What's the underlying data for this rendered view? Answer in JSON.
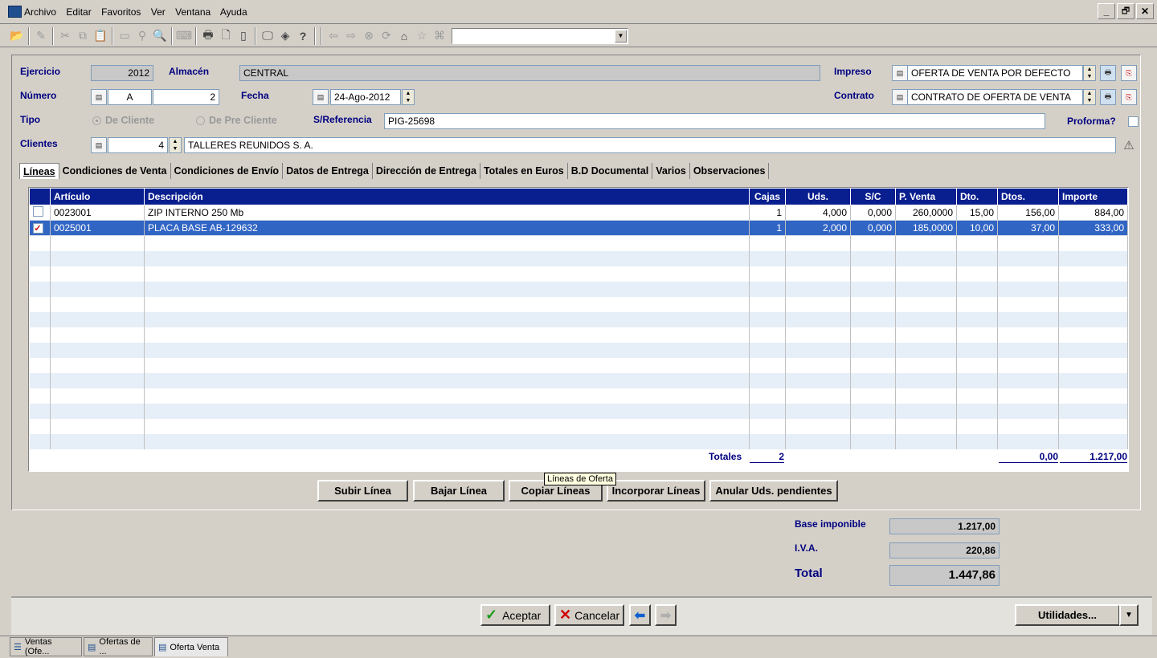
{
  "menu": {
    "items": [
      "Archivo",
      "Editar",
      "Favoritos",
      "Ver",
      "Ventana",
      "Ayuda"
    ]
  },
  "window_controls": {
    "minimize": "_",
    "restore": "🗗",
    "close": "✕"
  },
  "header": {
    "ejercicio_label": "Ejercicio",
    "ejercicio_value": "2012",
    "almacen_label": "Almacén",
    "almacen_value": "CENTRAL",
    "impreso_label": "Impreso",
    "impreso_value": "OFERTA DE VENTA POR DEFECTO",
    "numero_label": "Número",
    "numero_serie": "A",
    "numero_value": "2",
    "fecha_label": "Fecha",
    "fecha_value": "24-Ago-2012",
    "contrato_label": "Contrato",
    "contrato_value": "CONTRATO DE OFERTA DE VENTA",
    "tipo_label": "Tipo",
    "tipo_opt1": "De Cliente",
    "tipo_opt2": "De Pre Cliente",
    "sref_label": "S/Referencia",
    "sref_value": "PIG-25698",
    "proforma_label": "Proforma?",
    "clientes_label": "Clientes",
    "cliente_code": "4",
    "cliente_name": "TALLERES REUNIDOS S. A."
  },
  "tabs": [
    "Líneas",
    "Condiciones de Venta",
    "Condiciones de Envío",
    "Datos de Entrega",
    "Dirección de Entrega",
    "Totales en Euros",
    "B.D Documental",
    "Varios",
    "Observaciones"
  ],
  "grid": {
    "columns": [
      "Artículo",
      "Descripción",
      "Cajas",
      "Uds.",
      "S/C",
      "P. Venta",
      "Dto.",
      "Dtos.",
      "Importe"
    ],
    "rows": [
      {
        "checked": false,
        "articulo": "0023001",
        "descripcion": "ZIP INTERNO 250 Mb",
        "cajas": "1",
        "uds": "4,000",
        "sc": "0,000",
        "pventa": "260,0000",
        "dto": "15,00",
        "dtos": "156,00",
        "importe": "884,00"
      },
      {
        "checked": true,
        "articulo": "0025001",
        "descripcion": "PLACA BASE AB-129632",
        "cajas": "1",
        "uds": "2,000",
        "sc": "0,000",
        "pventa": "185,0000",
        "dto": "10,00",
        "dtos": "37,00",
        "importe": "333,00"
      }
    ],
    "totales_label": "Totales",
    "total_cajas": "2",
    "total_dtos": "0,00",
    "total_importe": "1.217,00"
  },
  "tooltip": "Líneas de Oferta",
  "line_buttons": {
    "subir": "Subir Línea",
    "bajar": "Bajar Línea",
    "copiar": "Copiar Líneas",
    "incorporar": "Incorporar Líneas",
    "anular": "Anular Uds. pendientes"
  },
  "summary": {
    "base_label": "Base imponible",
    "base_value": "1.217,00",
    "iva_label": "I.V.A.",
    "iva_value": "220,86",
    "total_label": "Total",
    "total_value": "1.447,86"
  },
  "footer": {
    "aceptar": "Aceptar",
    "cancelar": "Cancelar",
    "utilidades": "Utilidades..."
  },
  "taskbar": [
    "Ventas (Ofe...",
    "Ofertas de ...",
    "Oferta Venta"
  ]
}
